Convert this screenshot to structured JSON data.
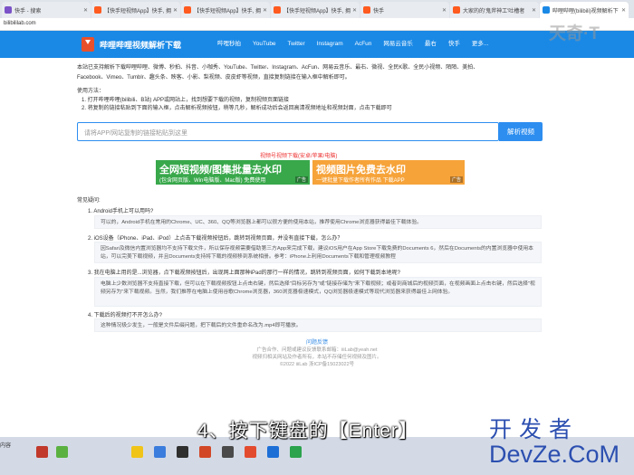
{
  "browser": {
    "tabs": [
      {
        "label": "快手 - 搜索",
        "fav": "#7b52c7"
      },
      {
        "label": "【快手短视频App】快手, 拥",
        "fav": "#ff5a1f"
      },
      {
        "label": "【快手短视频App】快手, 拥",
        "fav": "#ff5a1f"
      },
      {
        "label": "【快手短视频App】快手, 拥",
        "fav": "#ff5a1f"
      },
      {
        "label": "快手",
        "fav": "#ff5a1f"
      },
      {
        "label": "大家的的'鬼斧神工'吐槽者",
        "fav": "#ff5a1f"
      },
      {
        "label": "哔哩哔哩(bilibili)视频解析下",
        "fav": "#1a89e6"
      }
    ],
    "address": "bilibililab.com"
  },
  "header": {
    "brand": "哔哩哔哩视频解析下载",
    "nav": [
      "哔哩秒拍",
      "YouTube",
      "Twitter",
      "Instagram",
      "AcFun",
      "网易云音乐",
      "最右",
      "快手",
      "更多..."
    ]
  },
  "intro": {
    "text": "本站已支持解析下载哔哩哔哩、微博、秒拍、抖音、小咖秀、YouTube、Twitter、Instagram、AcFun、网易云音乐、最右、微视、全民K歌、全民小视频、陌陌、美拍、Facebook、Vimeo、Tumblr、趣头条、映客、小影、梨视频、皮皮虾等视频，直接复制链接在输入框中解析即可。",
    "howto": "使用方法：",
    "steps": [
      "1. 打开哔哩哔哩(bilibili、B站) APP或网站上，找到想要下载的视频，复制视频页面链接",
      "2. 将复制的链接粘贴到下面的输入框，点击解析视频按钮，稍等几秒，解析成功后会返回高清视频地址和视频封面，点击下载即可"
    ]
  },
  "search": {
    "placeholder": "请将APP/网站复制的链接粘贴到这里",
    "button": "解析视频"
  },
  "promo": {
    "text": "视频号视频下载(安卓/苹果/电脑)",
    "ad1_title": "全网短视频/图集批量去水印",
    "ad1_sub": "(包含网页版、Win电脑版、Mac版) 免费使用",
    "ad1_tag": "广告",
    "ad2_title": "视频图片免费去水印",
    "ad2_sub": "一键批量下载作者所有作品   下载APP",
    "ad2_tag": "广告"
  },
  "faq": {
    "heading": "常见疑问:",
    "items": [
      {
        "q": "1. Android手机上可以用吗?",
        "a": "可以的，Android手机在常用的Chrome、UC、360、QQ等浏览器上都可以很方便的使用本站，推荐使用Chrome浏览器获得最佳下载体验。"
      },
      {
        "q": "2. iOS设备（iPhone、iPad、iPod）上点击下载视频按钮后，跳转到视频页面，并没有直接下载，怎么办？",
        "a": "因Safari及微信内置浏览器均不支持下载文件，所以保存视频需要借助第三方App来完成下载，建议iOS用户在App Store下载免费的Documents 6，然后在Documents的内置浏览器中使用本站，可以完美下载视频，并且Documents支持将下载的视频移到系统相册。参考：iPhone上利用Documents下载和管理视频教程"
      },
      {
        "q": "3. 我在电脑上用的是...浏览器，点下载视频按钮后，出现网上面那种iPad的那行一样的情况，跳转到视频页面，如何下载到本地呢?",
        "a": "电脑上少数浏览器不支持直接下载，但可以在下载视频按钮上点击右键，然后选择\"目标另存为\"或\"链接存储为\"来下载视频；或者到商城后的视频页面，在视频画面上点击右键，然后选择\"视频另存为\"来下载视频。当然，我们推荐在电脑上使用谷歌Chrome浏览器，360浏览器极速模式，QQ浏览器极速模式等现代浏览器来获得最佳上网体验。"
      },
      {
        "q": "4. 下载后的视频打不开怎么办?",
        "a": "这种情况极少发生，一般是文件后缀问题，把下载后的文件重命名改为.mp4即可播放。"
      }
    ]
  },
  "footer": {
    "link": "问题反馈",
    "line1": "广告合作、问题或建议反馈联系邮箱：iiiLab@yeah.net",
    "line2": "视频归相关网站及作者所有，本站不存储任何视频及图片。",
    "line3": "©2022 iiiLab 浙ICP备15023022号"
  },
  "overlay": {
    "subtitle": "4、按下键盘的【Enter】",
    "watermark_top": "天奇·T",
    "watermark_br1": "开发者",
    "watermark_br2": "DevZe.CoM"
  },
  "taskbar": {
    "left_text": "内容"
  }
}
